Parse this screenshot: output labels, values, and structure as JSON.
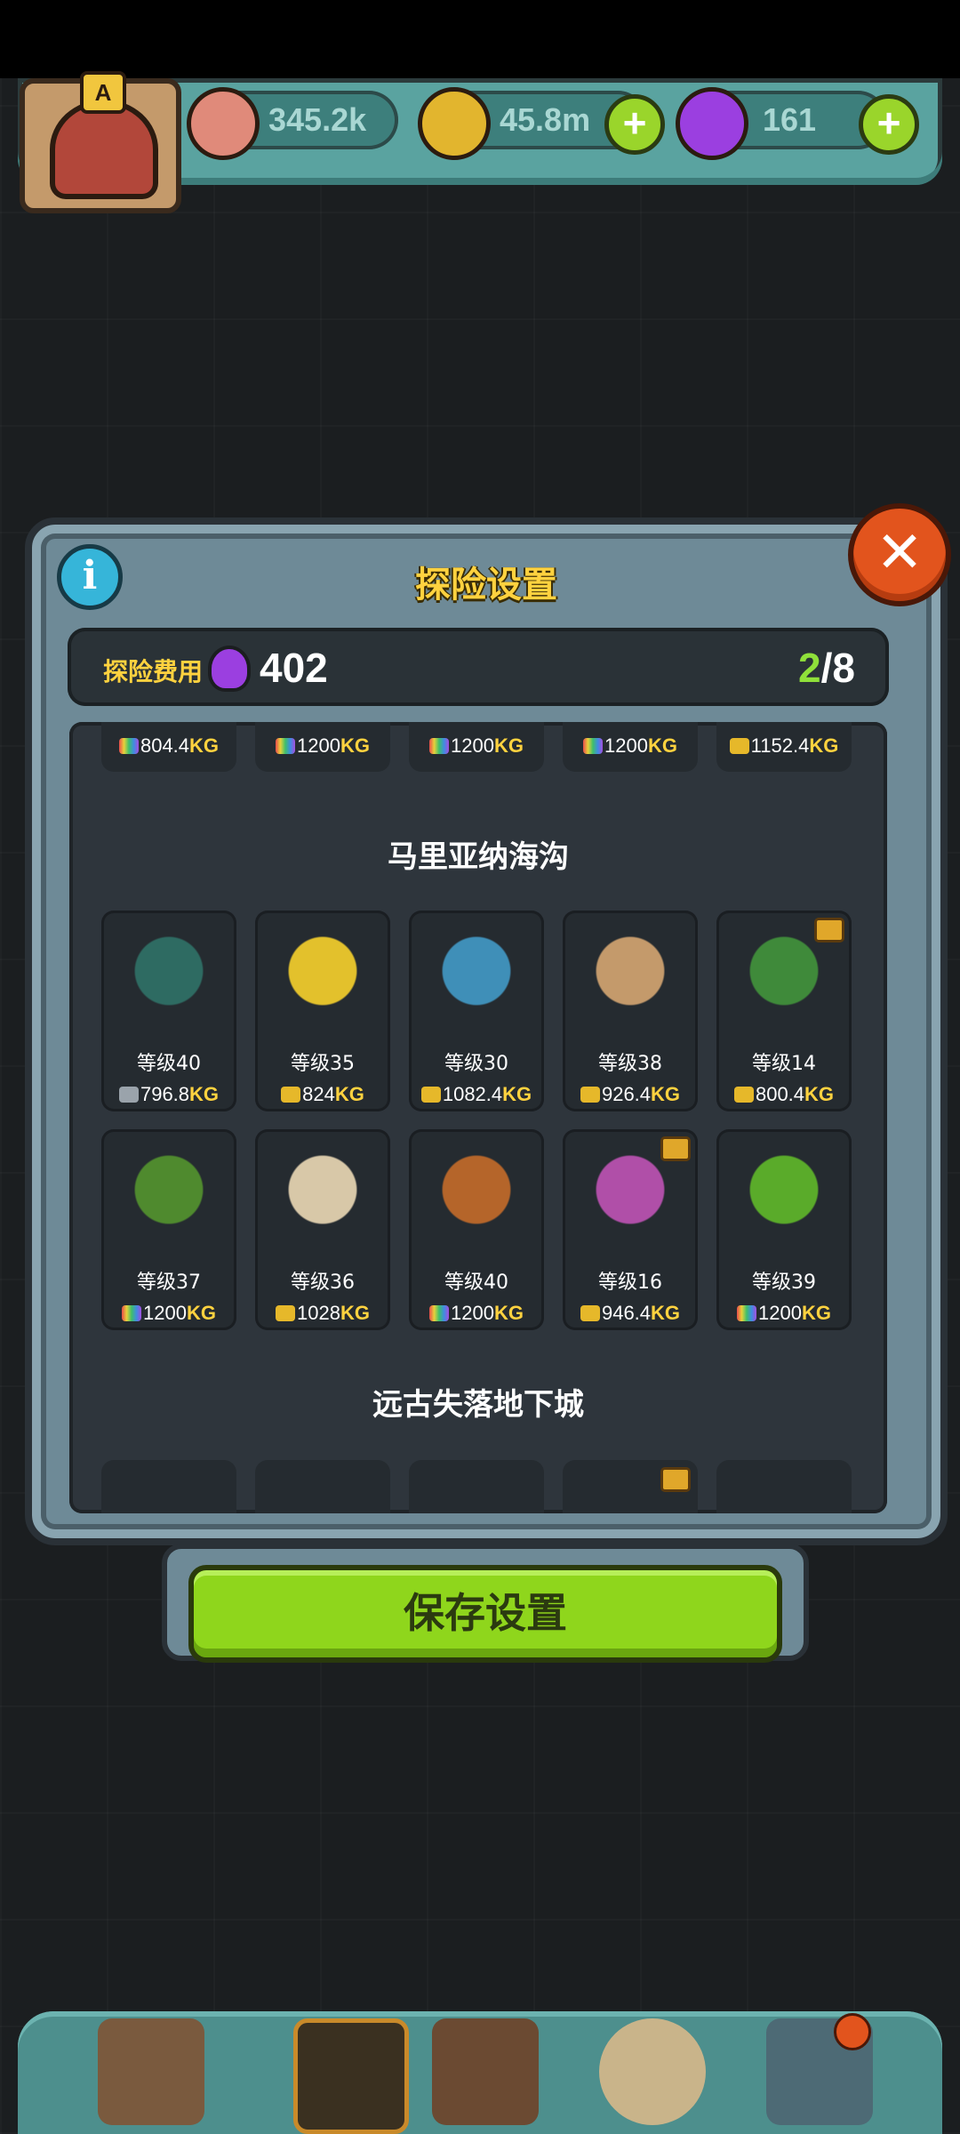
{
  "topbar": {
    "avatar_badge": "A",
    "eyes": "345.2k",
    "coins": "45.8m",
    "potions": "161",
    "plus_label": "+"
  },
  "dialog": {
    "title": "探险设置",
    "info_label": "i",
    "close_label": "✕",
    "cost_label": "探险费用",
    "cost_value": "402",
    "slots_used": "2",
    "slots_total": "/8",
    "save_label": "保存设置"
  },
  "top_row": [
    "804.4",
    "1200",
    "1200",
    "1200",
    "1152.4"
  ],
  "section1": {
    "title": "马里亚纳海沟",
    "cards": [
      {
        "level": "等级40",
        "weight": "796.8",
        "bag": "grey",
        "chest": false,
        "color": "#2e6b62"
      },
      {
        "level": "等级35",
        "weight": "824",
        "bag": "gold",
        "chest": false,
        "color": "#e3c12c"
      },
      {
        "level": "等级30",
        "weight": "1082.4",
        "bag": "gold",
        "chest": false,
        "color": "#3f8fb8"
      },
      {
        "level": "等级38",
        "weight": "926.4",
        "bag": "gold",
        "chest": false,
        "color": "#c49a6b"
      },
      {
        "level": "等级14",
        "weight": "800.4",
        "bag": "gold",
        "chest": true,
        "color": "#3f8a3a"
      },
      {
        "level": "等级37",
        "weight": "1200",
        "bag": "rain",
        "chest": false,
        "color": "#4f8a2e"
      },
      {
        "level": "等级36",
        "weight": "1028",
        "bag": "gold",
        "chest": false,
        "color": "#d8c8a8"
      },
      {
        "level": "等级40",
        "weight": "1200",
        "bag": "rain",
        "chest": false,
        "color": "#b5652a"
      },
      {
        "level": "等级16",
        "weight": "946.4",
        "bag": "gold",
        "chest": true,
        "color": "#b04fa8"
      },
      {
        "level": "等级39",
        "weight": "1200",
        "bag": "rain",
        "chest": false,
        "color": "#5aab2a"
      }
    ]
  },
  "section2": {
    "title": "远古失落地下城"
  },
  "kg_unit": "KG"
}
